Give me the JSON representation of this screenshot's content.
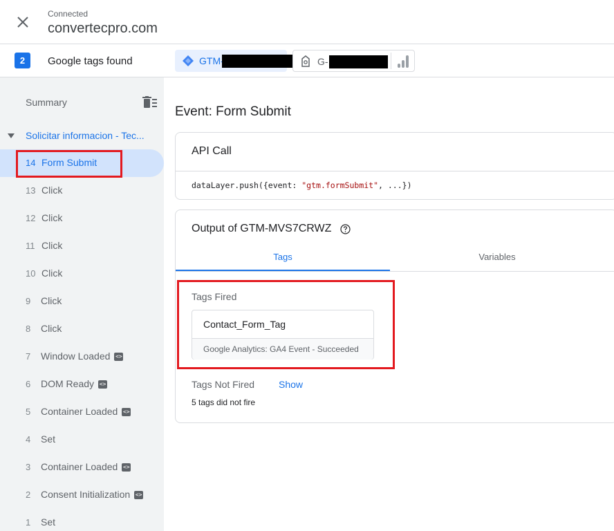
{
  "header": {
    "status_label": "Connected",
    "domain": "convertecpro.com"
  },
  "tags_found": {
    "count": "2",
    "label": "Google tags found",
    "chips": [
      {
        "label": "GTM-",
        "icon": "gtm-diamond-icon",
        "active": true
      },
      {
        "label": "G-",
        "icon": "gtag-icon",
        "active": false
      }
    ]
  },
  "sidebar": {
    "summary_label": "Summary",
    "group_label": "Solicitar informacion - Tec...",
    "events": [
      {
        "num": "14",
        "name": "Form Submit",
        "active": true,
        "code_badge": false
      },
      {
        "num": "13",
        "name": "Click",
        "code_badge": false
      },
      {
        "num": "12",
        "name": "Click",
        "code_badge": false
      },
      {
        "num": "11",
        "name": "Click",
        "code_badge": false
      },
      {
        "num": "10",
        "name": "Click",
        "code_badge": false
      },
      {
        "num": "9",
        "name": "Click",
        "code_badge": false
      },
      {
        "num": "8",
        "name": "Click",
        "code_badge": false
      },
      {
        "num": "7",
        "name": "Window Loaded",
        "code_badge": true
      },
      {
        "num": "6",
        "name": "DOM Ready",
        "code_badge": true
      },
      {
        "num": "5",
        "name": "Container Loaded",
        "code_badge": true
      },
      {
        "num": "4",
        "name": "Set",
        "code_badge": false
      },
      {
        "num": "3",
        "name": "Container Loaded",
        "code_badge": true
      },
      {
        "num": "2",
        "name": "Consent Initialization",
        "code_badge": true
      },
      {
        "num": "1",
        "name": "Set",
        "code_badge": false
      }
    ]
  },
  "main": {
    "event_title": "Event: Form Submit",
    "api_call": {
      "title": "API Call",
      "code_prefix": "dataLayer.push({event: ",
      "code_string": "\"gtm.formSubmit\"",
      "code_suffix": ", ...})"
    },
    "output": {
      "title": "Output of GTM-MVS7CRWZ",
      "tabs": [
        "Tags",
        "Variables"
      ],
      "tags_fired_label": "Tags Fired",
      "fired_tag": {
        "name": "Contact_Form_Tag",
        "status": "Google Analytics: GA4 Event - Succeeded"
      },
      "tags_not_fired_label": "Tags Not Fired",
      "show_label": "Show",
      "not_fired_count": "5 tags did not fire"
    }
  },
  "colors": {
    "accent": "#1a73e8",
    "highlight": "#e3191f",
    "sidebar_bg": "#f1f3f4",
    "active_item_bg": "#d2e3fc"
  }
}
